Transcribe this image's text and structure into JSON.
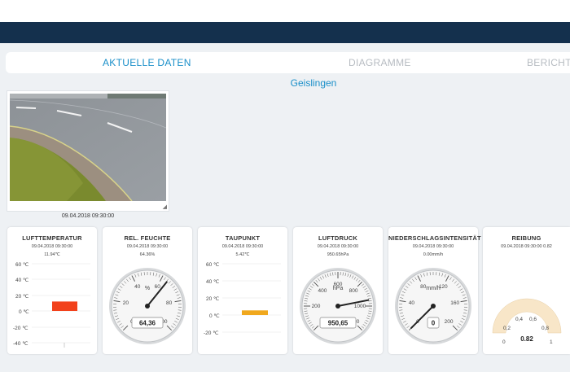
{
  "tabs": [
    {
      "label": "AKTUELLE DATEN"
    },
    {
      "label": "DIAGRAMME"
    },
    {
      "label": "BERICHT"
    }
  ],
  "station": "Geislingen",
  "camera": {
    "timestamp": "09.04.2018 09:30:00"
  },
  "cards": [
    {
      "title": "LUFTTEMPERATUR",
      "timestamp": "09.04.2018 09:30:00",
      "value": "11.94℃",
      "scale": [
        "60 ℃",
        "40 ℃",
        "20 ℃",
        "0 ℃",
        "-20 ℃",
        "-40 ℃"
      ],
      "bar_value": 11.94,
      "bar_color": "#f2411b"
    },
    {
      "title": "REL. FEUCHTE",
      "timestamp": "09.04.2018 09:30:00",
      "value": "64.36%",
      "dial_unit": "%",
      "dial_value": "64,36",
      "ticks": [
        "0",
        "20",
        "40",
        "60",
        "80",
        "100"
      ],
      "needle_fraction": 0.6436
    },
    {
      "title": "TAUPUNKT",
      "timestamp": "09.04.2018 09:30:00",
      "value": "5.42℃",
      "scale": [
        "60 ℃",
        "40 ℃",
        "20 ℃",
        "0 ℃",
        "-20 ℃"
      ],
      "bar_value": 5.42,
      "bar_color": "#f0a81e"
    },
    {
      "title": "LUFTDRUCK",
      "timestamp": "09.04.2018 09:30:00",
      "value": "950.65hPa",
      "dial_unit": "hPa",
      "dial_value": "950,65",
      "ticks": [
        "0",
        "200",
        "400",
        "600",
        "800",
        "1000",
        "1200"
      ],
      "needle_fraction": 0.7922
    },
    {
      "title": "NIEDERSCHLAGSINTENSITÄT",
      "timestamp": "09.04.2018 09:30:00",
      "value": "0.00mm/h",
      "dial_unit": "mm/h",
      "dial_value": "0",
      "ticks": [
        "0",
        "40",
        "80",
        "120",
        "160",
        "200"
      ],
      "needle_fraction": 0.0
    },
    {
      "title": "REIBUNG",
      "timestamp": "09.04.2018 09:30:00 0.82",
      "value": "",
      "ticks": [
        "0",
        "0,2",
        "0,4",
        "0,6",
        "0,8",
        "1"
      ],
      "dial_value": "0.82",
      "needle_fraction": 0.82
    }
  ]
}
